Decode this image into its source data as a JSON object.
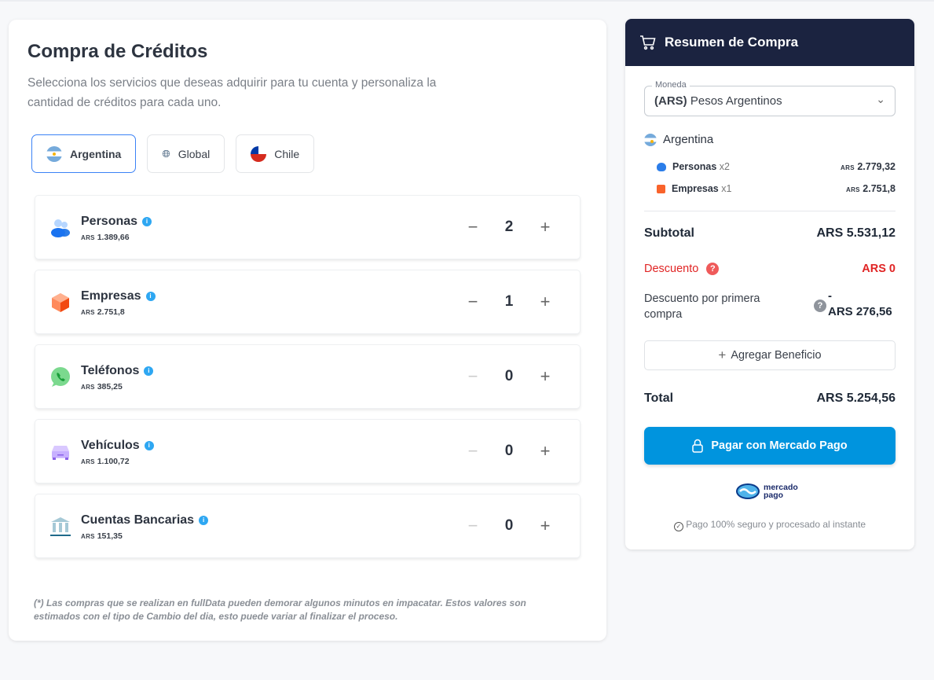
{
  "left": {
    "title_light": "Compra de",
    "title_bold": "Créditos",
    "subtitle": "Selecciona los servicios que deseas adquirir para tu cuenta y personaliza la cantidad de créditos para cada uno.",
    "tabs": [
      {
        "label": "Argentina",
        "icon": "argentina-flag-icon",
        "active": true
      },
      {
        "label": "Global",
        "icon": "globe-icon",
        "active": false
      },
      {
        "label": "Chile",
        "icon": "chile-flag-icon",
        "active": false
      }
    ],
    "products": [
      {
        "name": "Personas",
        "currency": "ARS",
        "price": "1.389,66",
        "qty": "2",
        "icon": "people-icon"
      },
      {
        "name": "Empresas",
        "currency": "ARS",
        "price": "2.751,8",
        "qty": "1",
        "icon": "cube-icon"
      },
      {
        "name": "Teléfonos",
        "currency": "ARS",
        "price": "385,25",
        "qty": "0",
        "icon": "whatsapp-icon"
      },
      {
        "name": "Vehículos",
        "currency": "ARS",
        "price": "1.100,72",
        "qty": "0",
        "icon": "car-icon"
      },
      {
        "name": "Cuentas Bancarias",
        "currency": "ARS",
        "price": "151,35",
        "qty": "0",
        "icon": "bank-icon"
      }
    ],
    "footnote": "(*) Las compras que se realizan en fullData pueden demorar algunos minutos en impacatar. Estos valores son estimados con el tipo de Cambio del dia, esto puede variar al finalizar el proceso."
  },
  "summary": {
    "title": "Resumen de Compra",
    "currency_label": "Moneda",
    "currency_code": "(ARS)",
    "currency_name": "Pesos Argentinos",
    "country": "Argentina",
    "items": [
      {
        "name": "Personas",
        "qty": "x2",
        "currency": "ARS",
        "amount": "2.779,32"
      },
      {
        "name": "Empresas",
        "qty": "x1",
        "currency": "ARS",
        "amount": "2.751,8"
      }
    ],
    "subtotal_label": "Subtotal",
    "subtotal": "ARS 5.531,12",
    "discount_label": "Descuento",
    "discount": "ARS 0",
    "first_label": "Descuento por primera compra",
    "first_sign": "-",
    "first_value": "ARS 276,56",
    "benefit_label": "Agregar Beneficio",
    "total_label": "Total",
    "total": "ARS 5.254,56",
    "pay_label": "Pagar con Mercado Pago",
    "logo_text": "mercado pago",
    "secure_text": "Pago 100% seguro y procesado al instante",
    "colors": {
      "header": "#1b2340",
      "pay": "#0094de",
      "discount": "#e02424"
    }
  }
}
